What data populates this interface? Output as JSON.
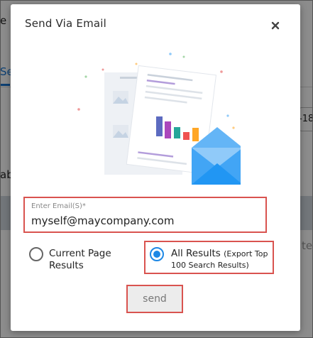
{
  "background": {
    "frag_e": "e",
    "frag_se": "Se",
    "frag_18": "-18",
    "frag_ab": "ab",
    "frag_te": "te"
  },
  "modal": {
    "title": "Send Via Email",
    "close_icon": "close-icon",
    "illustration": "document-chart-envelope-illustration",
    "email": {
      "label": "Enter Email(S)*",
      "value": "myself@maycompany.com",
      "placeholder": ""
    },
    "options": [
      {
        "label_line1": "Current Page",
        "label_line2": "Results",
        "checked": false
      },
      {
        "label_line1": "All Results",
        "label_sub1": "(Export Top",
        "label_line2": "100 Search Results)",
        "checked": true
      }
    ],
    "send_label": "send"
  },
  "colors": {
    "accent": "#1e88e5",
    "highlight_border": "#d9534f",
    "envelope": "#42a5f5",
    "bars": [
      "#5c6bc0",
      "#ab47bc",
      "#26a69a",
      "#ef5350",
      "#ffa726"
    ]
  }
}
